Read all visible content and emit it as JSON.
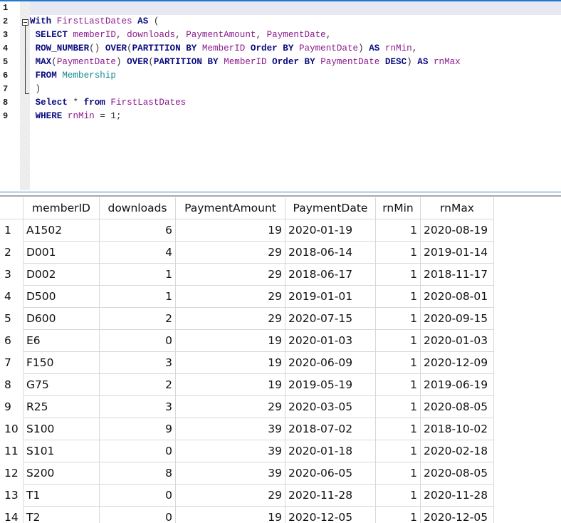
{
  "editor": {
    "line_numbers": [
      "1",
      "2",
      "3",
      "4",
      "5",
      "6",
      "7",
      "8",
      "9"
    ],
    "lines": [
      [],
      [
        [
          "kw",
          "With"
        ],
        [
          "op",
          " "
        ],
        [
          "id",
          "FirstLastDates"
        ],
        [
          "op",
          " "
        ],
        [
          "kw",
          "AS"
        ],
        [
          "op",
          " ("
        ]
      ],
      [
        [
          "op",
          " "
        ],
        [
          "kw",
          "SELECT"
        ],
        [
          "op",
          " "
        ],
        [
          "id",
          "memberID"
        ],
        [
          "op",
          ", "
        ],
        [
          "id",
          "downloads"
        ],
        [
          "op",
          ", "
        ],
        [
          "id",
          "PaymentAmount"
        ],
        [
          "op",
          ", "
        ],
        [
          "id",
          "PaymentDate"
        ],
        [
          "op",
          ","
        ]
      ],
      [
        [
          "op",
          " "
        ],
        [
          "fn",
          "ROW_NUMBER"
        ],
        [
          "op",
          "() "
        ],
        [
          "kw",
          "OVER"
        ],
        [
          "op",
          "("
        ],
        [
          "kw",
          "PARTITION BY"
        ],
        [
          "op",
          " "
        ],
        [
          "id",
          "MemberID"
        ],
        [
          "op",
          " "
        ],
        [
          "kw",
          "Order BY"
        ],
        [
          "op",
          " "
        ],
        [
          "id",
          "PaymentDate"
        ],
        [
          "op",
          ") "
        ],
        [
          "kw",
          "AS"
        ],
        [
          "op",
          " "
        ],
        [
          "id",
          "rnMin"
        ],
        [
          "op",
          ","
        ]
      ],
      [
        [
          "op",
          " "
        ],
        [
          "fn",
          "MAX"
        ],
        [
          "op",
          "("
        ],
        [
          "id",
          "PaymentDate"
        ],
        [
          "op",
          ") "
        ],
        [
          "kw",
          "OVER"
        ],
        [
          "op",
          "("
        ],
        [
          "kw",
          "PARTITION BY"
        ],
        [
          "op",
          " "
        ],
        [
          "id",
          "MemberID"
        ],
        [
          "op",
          " "
        ],
        [
          "kw",
          "Order BY"
        ],
        [
          "op",
          " "
        ],
        [
          "id",
          "PaymentDate"
        ],
        [
          "op",
          " "
        ],
        [
          "kw",
          "DESC"
        ],
        [
          "op",
          ") "
        ],
        [
          "kw",
          "AS"
        ],
        [
          "op",
          " "
        ],
        [
          "id",
          "rnMax"
        ]
      ],
      [
        [
          "op",
          " "
        ],
        [
          "kw",
          "FROM"
        ],
        [
          "op",
          " "
        ],
        [
          "obj",
          "Membership"
        ]
      ],
      [
        [
          "op",
          " )"
        ]
      ],
      [
        [
          "op",
          " "
        ],
        [
          "kw",
          "Select"
        ],
        [
          "op",
          " * "
        ],
        [
          "kw",
          "from"
        ],
        [
          "op",
          " "
        ],
        [
          "id",
          "FirstLastDates"
        ]
      ],
      [
        [
          "op",
          " "
        ],
        [
          "kw",
          "WHERE"
        ],
        [
          "op",
          " "
        ],
        [
          "id",
          "rnMin"
        ],
        [
          "op",
          " = 1;"
        ]
      ]
    ]
  },
  "results": {
    "columns": [
      "memberID",
      "downloads",
      "PaymentAmount",
      "PaymentDate",
      "rnMin",
      "rnMax"
    ],
    "rows": [
      [
        "1",
        "A1502",
        "6",
        "19",
        "2020-01-19",
        "1",
        "2020-08-19"
      ],
      [
        "2",
        "D001",
        "4",
        "29",
        "2018-06-14",
        "1",
        "2019-01-14"
      ],
      [
        "3",
        "D002",
        "1",
        "29",
        "2018-06-17",
        "1",
        "2018-11-17"
      ],
      [
        "4",
        "D500",
        "1",
        "29",
        "2019-01-01",
        "1",
        "2020-08-01"
      ],
      [
        "5",
        "D600",
        "2",
        "29",
        "2020-07-15",
        "1",
        "2020-09-15"
      ],
      [
        "6",
        "E6",
        "0",
        "19",
        "2020-01-03",
        "1",
        "2020-01-03"
      ],
      [
        "7",
        "F150",
        "3",
        "19",
        "2020-06-09",
        "1",
        "2020-12-09"
      ],
      [
        "8",
        "G75",
        "2",
        "19",
        "2019-05-19",
        "1",
        "2019-06-19"
      ],
      [
        "9",
        "R25",
        "3",
        "29",
        "2020-03-05",
        "1",
        "2020-08-05"
      ],
      [
        "10",
        "S100",
        "9",
        "39",
        "2018-07-02",
        "1",
        "2018-10-02"
      ],
      [
        "11",
        "S101",
        "0",
        "39",
        "2020-01-18",
        "1",
        "2020-02-18"
      ],
      [
        "12",
        "S200",
        "8",
        "39",
        "2020-06-05",
        "1",
        "2020-08-05"
      ],
      [
        "13",
        "T1",
        "0",
        "29",
        "2020-11-28",
        "1",
        "2020-11-28"
      ],
      [
        "14",
        "T2",
        "0",
        "19",
        "2020-12-05",
        "1",
        "2020-12-05"
      ]
    ]
  },
  "colors": {
    "keyword": "#0a0a80",
    "identifier": "#8b1a8b",
    "object": "#148a8a",
    "editor_border": "#1f7acd"
  }
}
